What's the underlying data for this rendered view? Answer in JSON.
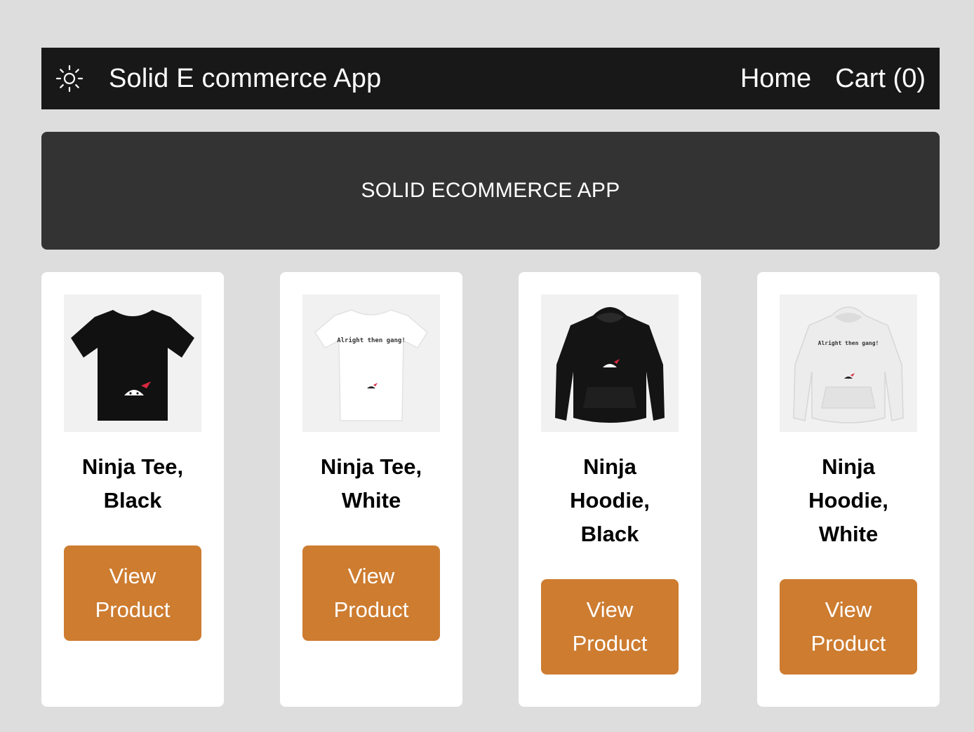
{
  "navbar": {
    "theme_icon": "sun-icon",
    "title": "Solid E commerce App",
    "links": {
      "home": "Home",
      "cart": "Cart (0)"
    }
  },
  "banner": {
    "text": "SOLID ECOMMERCE APP"
  },
  "products": [
    {
      "name": "Ninja Tee, Black",
      "button": "View Product",
      "image_text": ""
    },
    {
      "name": "Ninja Tee, White",
      "button": "View Product",
      "image_text": "Alright then gang!"
    },
    {
      "name": "Ninja Hoodie, Black",
      "button": "View Product",
      "image_text": ""
    },
    {
      "name": "Ninja Hoodie, White",
      "button": "View Product",
      "image_text": "Alright then gang!"
    }
  ],
  "colors": {
    "page_background": "#dddddd",
    "navbar_background": "#181818",
    "banner_background": "#333333",
    "button": "#cd7c30"
  }
}
